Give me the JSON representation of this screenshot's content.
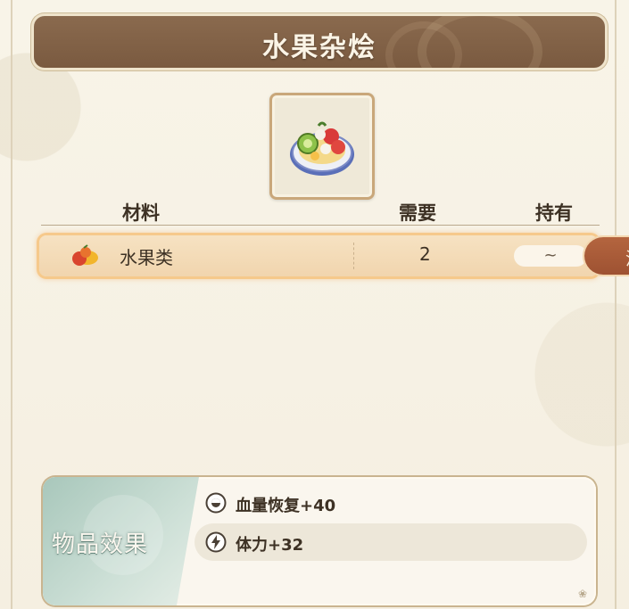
{
  "title": "水果杂烩",
  "item_icon": "fruit-salad-icon",
  "table": {
    "headers": {
      "material": "材料",
      "need": "需要",
      "owned": "持有"
    },
    "rows": [
      {
        "icon": "fruit-icon",
        "name": "水果类",
        "need": "2",
        "owned": "~"
      }
    ]
  },
  "side_tab": {
    "label": "没"
  },
  "effects": {
    "title": "物品效果",
    "items": [
      {
        "icon": "hp-restore-icon",
        "text": "血量恢复+40"
      },
      {
        "icon": "stamina-icon",
        "text": "体力+32"
      }
    ]
  },
  "colors": {
    "banner": "#7a5a40",
    "row_highlight": "#f1d5ae",
    "row_glow": "#f6c98b",
    "side_tab": "#9e5232",
    "effect_accent": "#a8c7bb"
  }
}
